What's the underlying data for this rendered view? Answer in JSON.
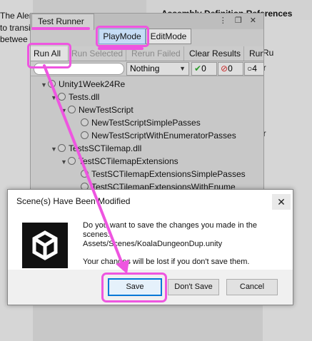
{
  "background": {
    "left_text": [
      "The Alert",
      "to transi",
      "betwee"
    ],
    "top_right_text": "Assembly Definition References",
    "right_texts": [
      "Ru",
      "er",
      "er"
    ]
  },
  "test_runner": {
    "title": "Test Runner",
    "window_icons": "⋮ ❐ ✕",
    "modes": [
      "PlayMode",
      "EditMode"
    ],
    "toolbar": {
      "run_all": "Run All",
      "run_selected": "Run Selected",
      "rerun_failed": "Rerun Failed",
      "clear_results": "Clear Results",
      "run_extra": "Run"
    },
    "filter": {
      "dropdown_value": "Nothing",
      "passed_count": "0",
      "failed_count": "0",
      "skipped_count": "4"
    },
    "tree": [
      "Unity1Week24Re",
      "Tests.dll",
      "NewTestScript",
      "NewTestScriptSimplePasses",
      "NewTestScriptWithEnumeratorPasses",
      "TestsSCTilemap.dll",
      "TestSCTilemapExtensions",
      "TestSCTilemapExtensionsSimplePasses",
      "TestSCTilemapExtensionsWithEnume"
    ]
  },
  "dialog": {
    "title": "Scene(s) Have Been Modified",
    "close_glyph": "✕",
    "message_line1": "Do you want to save the changes you made in the",
    "message_line2": "scenes:",
    "message_line3": " Assets/Scenes/KoalaDungeonDup.unity",
    "message_line4": "Your changes will be lost if you don't save them.",
    "buttons": [
      "Save",
      "Don't Save",
      "Cancel"
    ]
  },
  "colors": {
    "highlight": "#ee55e0",
    "mode_active": "#c5dcf5",
    "pass_green": "#2a9a2a",
    "fail_red": "#c62828"
  }
}
